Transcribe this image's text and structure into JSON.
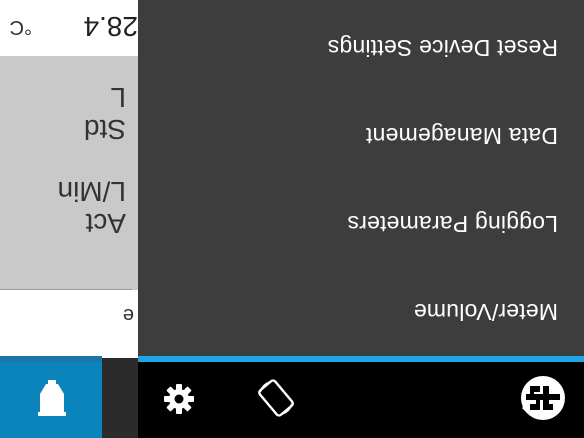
{
  "menu": {
    "items": [
      {
        "label": "Meter/Volume"
      },
      {
        "label": "Logging Parameters"
      },
      {
        "label": "Data Management"
      },
      {
        "label": "Reset Device Settings"
      }
    ]
  },
  "toolbar": {
    "icons": [
      "tsi-logo",
      "rotate-icon",
      "gear-icon",
      "pump-icon"
    ]
  },
  "readings": {
    "tab_text": "e",
    "act_label": "Act",
    "act_unit": "L/Min",
    "std_label": "Std",
    "std_unit": "L",
    "temp_value": "28.4",
    "temp_unit": "°C"
  },
  "colors": {
    "accent": "#1ea6e6",
    "menu_bg": "#3d3d3d",
    "toolbar_bg": "#000000",
    "active_tab": "#0a84ba"
  }
}
